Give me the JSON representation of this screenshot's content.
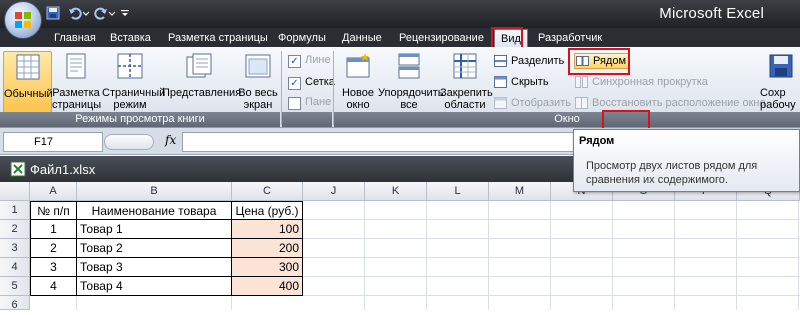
{
  "app": {
    "title": "Microsoft Excel"
  },
  "tabs": [
    {
      "label": "Главная"
    },
    {
      "label": "Вставка"
    },
    {
      "label": "Разметка страницы"
    },
    {
      "label": "Формулы"
    },
    {
      "label": "Данные"
    },
    {
      "label": "Рецензирование"
    },
    {
      "label": "Вид"
    },
    {
      "label": "Разработчик"
    }
  ],
  "active_tab": "Вид",
  "ribbon": {
    "views": {
      "normal": "Обычный",
      "page_layout_1": "Разметка",
      "page_layout_2": "страницы",
      "page_break_1": "Страничный",
      "page_break_2": "режим",
      "custom": "Представления",
      "fullscreen_1": "Во весь",
      "fullscreen_2": "экран",
      "group_label": "Режимы просмотра книги"
    },
    "show": {
      "ruler": "Лине",
      "gridlines": "Сетка",
      "messagebar": "Пане"
    },
    "window": {
      "new_1": "Новое",
      "new_2": "окно",
      "arrange_1": "Упорядочить",
      "arrange_2": "все",
      "freeze_1": "Закрепить",
      "freeze_2": "области",
      "split": "Разделить",
      "hide": "Скрыть",
      "unhide": "Отобразить",
      "side_by_side": "Рядом",
      "sync_scroll": "Синхронная прокрутка",
      "reset_position": "Восстановить расположение окна",
      "save_1": "Сохр",
      "save_2": "рабочу",
      "group_label": "Окно"
    }
  },
  "formula_bar": {
    "name_box": "F17",
    "fx": "fx"
  },
  "workbook": {
    "title": "Файл1.xlsx"
  },
  "sheet": {
    "columns": [
      "A",
      "B",
      "C",
      "J",
      "K",
      "L",
      "M",
      "N",
      "O",
      "P",
      "Q"
    ],
    "rows": [
      "1",
      "2",
      "3",
      "4",
      "5",
      "6"
    ],
    "headers": [
      "№ п/п",
      "Наименование товара",
      "Цена (руб.)"
    ],
    "data": [
      {
        "n": "1",
        "name": "Товар 1",
        "price": "100"
      },
      {
        "n": "2",
        "name": "Товар 2",
        "price": "200"
      },
      {
        "n": "3",
        "name": "Товар 3",
        "price": "300"
      },
      {
        "n": "4",
        "name": "Товар 4",
        "price": "400"
      }
    ]
  },
  "tooltip": {
    "title": "Рядом",
    "text": "Просмотр двух листов рядом для сравнения их содержимого."
  },
  "colors": {
    "highlight": "#d8121d",
    "price_fill": "#fbe4d6"
  }
}
